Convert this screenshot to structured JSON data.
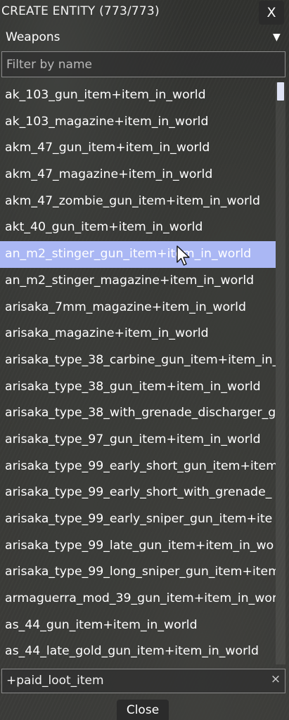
{
  "window": {
    "title": "CREATE ENTITY (773/773)",
    "close_label": "X"
  },
  "category": {
    "selected": "Weapons",
    "chevron_icon": "triangle-down-icon"
  },
  "filter": {
    "value": "",
    "placeholder": "Filter by name"
  },
  "entity_list": {
    "selected_index": 6,
    "items": [
      "ak_103_gun_item+item_in_world",
      "ak_103_magazine+item_in_world",
      "akm_47_gun_item+item_in_world",
      "akm_47_magazine+item_in_world",
      "akm_47_zombie_gun_item+item_in_world",
      "akt_40_gun_item+item_in_world",
      "an_m2_stinger_gun_item+item_in_world",
      "an_m2_stinger_magazine+item_in_world",
      "arisaka_7mm_magazine+item_in_world",
      "arisaka_magazine+item_in_world",
      "arisaka_type_38_carbine_gun_item+item_in_",
      "arisaka_type_38_gun_item+item_in_world",
      "arisaka_type_38_with_grenade_discharger_g",
      "arisaka_type_97_gun_item+item_in_world",
      "arisaka_type_99_early_short_gun_item+item",
      "arisaka_type_99_early_short_with_grenade_",
      "arisaka_type_99_early_sniper_gun_item+ite",
      "arisaka_type_99_late_gun_item+item_in_wo",
      "arisaka_type_99_long_sniper_gun_item+item",
      "armaguerra_mod_39_gun_item+item_in_wor",
      "as_44_gun_item+item_in_world",
      "as_44_late_gold_gun_item+item_in_world"
    ]
  },
  "tag_filter": {
    "value": "+paid_loot_item",
    "clear_label": "×"
  },
  "footer": {
    "close_label": "Close"
  },
  "colors": {
    "selection": "#aab7f4",
    "panel": "#202020"
  }
}
